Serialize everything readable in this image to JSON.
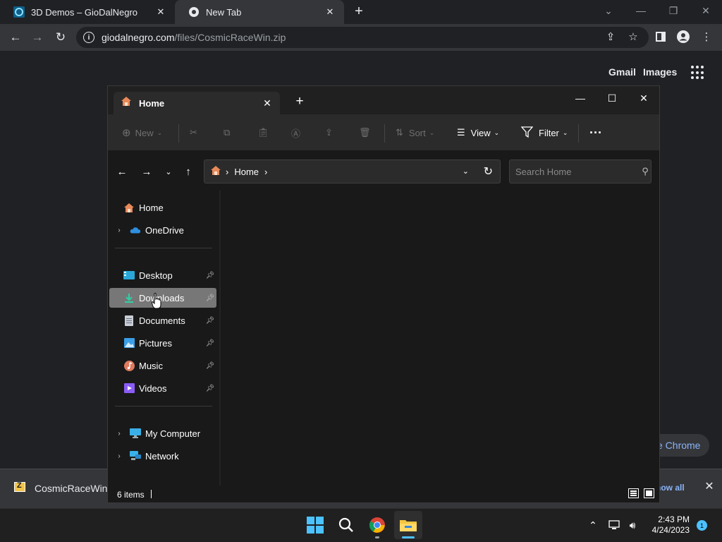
{
  "browser": {
    "tabs": [
      {
        "title": "3D Demos – GioDalNegro",
        "active": false
      },
      {
        "title": "New Tab",
        "active": true
      }
    ],
    "new_tab_label": "+",
    "address": {
      "host": "giodalnegro.com",
      "path": "/files/CosmicRaceWin.zip"
    },
    "links": {
      "gmail": "Gmail",
      "images": "Images"
    },
    "partial_pill": "e Chrome",
    "download": {
      "file_name": "CosmicRaceWin.zi",
      "show_all": "how all"
    }
  },
  "explorer": {
    "tab_title": "Home",
    "command_bar": {
      "new": "New",
      "sort": "Sort",
      "view": "View",
      "filter": "Filter"
    },
    "address_crumb": "Home",
    "search_placeholder": "Search Home",
    "nav": {
      "top": [
        {
          "label": "Home",
          "icon": "home-icon",
          "expandable": false
        },
        {
          "label": "OneDrive",
          "icon": "cloud-icon",
          "expandable": true
        }
      ],
      "quick_access": [
        {
          "label": "Desktop",
          "icon": "desktop-folder-icon",
          "pinned": true,
          "selected": false
        },
        {
          "label": "Downloads",
          "icon": "download-folder-icon",
          "pinned": true,
          "selected": true
        },
        {
          "label": "Documents",
          "icon": "documents-folder-icon",
          "pinned": true,
          "selected": false
        },
        {
          "label": "Pictures",
          "icon": "pictures-folder-icon",
          "pinned": true,
          "selected": false
        },
        {
          "label": "Music",
          "icon": "music-folder-icon",
          "pinned": true,
          "selected": false
        },
        {
          "label": "Videos",
          "icon": "videos-folder-icon",
          "pinned": true,
          "selected": false
        }
      ],
      "bottom": [
        {
          "label": "My Computer",
          "icon": "computer-icon",
          "expandable": true
        },
        {
          "label": "Network",
          "icon": "network-icon",
          "expandable": true
        }
      ]
    },
    "status": {
      "item_count": "6 items"
    }
  },
  "taskbar": {
    "time": "2:43 PM",
    "date": "4/24/2023",
    "notification_count": "1"
  },
  "colors": {
    "accent_blue": "#4cc2ff",
    "folder_yellow": "#f4c542",
    "selection_gray": "#777777"
  }
}
